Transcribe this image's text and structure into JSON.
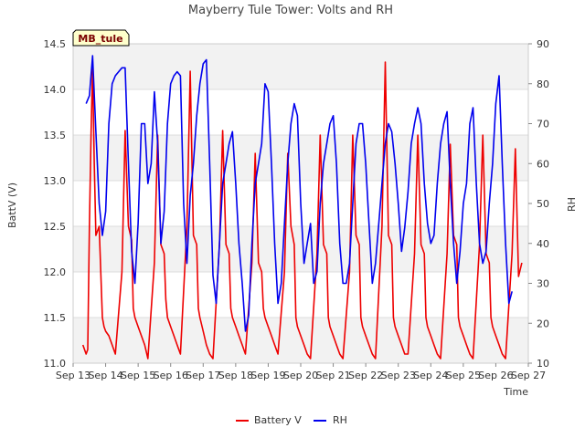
{
  "chart_data": {
    "type": "line",
    "title": "Mayberry Tule Tower: Volts and RH",
    "badge": "MB_tule",
    "xlabel": "Time",
    "ylabel_left": "BattV (V)",
    "ylabel_right": "RH",
    "x_ticks": [
      "Sep 13",
      "Sep 14",
      "Sep 15",
      "Sep 16",
      "Sep 17",
      "Sep 18",
      "Sep 19",
      "Sep 20",
      "Sep 21",
      "Sep 22",
      "Sep 23",
      "Sep 24",
      "Sep 25",
      "Sep 26",
      "Sep 27"
    ],
    "xlim_days": [
      13,
      27
    ],
    "ylim_left": [
      11.0,
      14.5
    ],
    "ylim_right": [
      10,
      90
    ],
    "y_ticks_left": [
      "11.0",
      "11.5",
      "12.0",
      "12.5",
      "13.0",
      "13.5",
      "14.0",
      "14.5"
    ],
    "y_ticks_right": [
      "10",
      "20",
      "30",
      "40",
      "50",
      "60",
      "70",
      "80",
      "90"
    ],
    "legend_position": "bottom-center",
    "series": [
      {
        "name": "Battery V",
        "color": "#ee0000",
        "axis": "left",
        "x_day": [
          13.3,
          13.4,
          13.45,
          13.5,
          13.55,
          13.6,
          13.65,
          13.7,
          13.8,
          13.9,
          13.95,
          14.0,
          14.1,
          14.2,
          14.3,
          14.5,
          14.6,
          14.7,
          14.8,
          14.85,
          14.9,
          15.0,
          15.1,
          15.2,
          15.3,
          15.5,
          15.6,
          15.7,
          15.8,
          15.85,
          15.9,
          16.0,
          16.1,
          16.2,
          16.3,
          16.5,
          16.6,
          16.7,
          16.8,
          16.85,
          16.9,
          17.0,
          17.1,
          17.2,
          17.3,
          17.5,
          17.6,
          17.7,
          17.8,
          17.85,
          17.9,
          18.0,
          18.1,
          18.2,
          18.3,
          18.5,
          18.6,
          18.7,
          18.8,
          18.85,
          18.9,
          19.0,
          19.1,
          19.2,
          19.3,
          19.5,
          19.6,
          19.7,
          19.8,
          19.85,
          19.9,
          20.0,
          20.1,
          20.2,
          20.3,
          20.5,
          20.6,
          20.7,
          20.8,
          20.85,
          20.9,
          21.0,
          21.1,
          21.2,
          21.3,
          21.5,
          21.6,
          21.7,
          21.8,
          21.85,
          21.9,
          22.0,
          22.1,
          22.2,
          22.3,
          22.5,
          22.6,
          22.7,
          22.8,
          22.85,
          22.9,
          23.0,
          23.1,
          23.2,
          23.3,
          23.5,
          23.6,
          23.7,
          23.8,
          23.85,
          23.9,
          24.0,
          24.1,
          24.2,
          24.3,
          24.5,
          24.6,
          24.7,
          24.8,
          24.85,
          24.9,
          25.0,
          25.1,
          25.2,
          25.3,
          25.5,
          25.6,
          25.7,
          25.8,
          25.85,
          25.9,
          26.0,
          26.1,
          26.2,
          26.3,
          26.5,
          26.6,
          26.7,
          26.8,
          26.85,
          26.9,
          27.0
        ],
        "values": [
          11.2,
          11.1,
          11.15,
          12.5,
          13.5,
          14.25,
          13.2,
          12.4,
          12.5,
          11.5,
          11.4,
          11.35,
          11.3,
          11.2,
          11.1,
          12.0,
          13.55,
          12.5,
          12.35,
          11.6,
          11.5,
          11.4,
          11.3,
          11.2,
          11.05,
          12.1,
          13.5,
          12.3,
          12.2,
          11.7,
          11.5,
          11.4,
          11.3,
          11.2,
          11.1,
          12.5,
          14.2,
          12.4,
          12.3,
          11.6,
          11.5,
          11.35,
          11.2,
          11.1,
          11.05,
          12.3,
          13.55,
          12.3,
          12.2,
          11.6,
          11.5,
          11.4,
          11.3,
          11.2,
          11.1,
          12.1,
          13.3,
          12.1,
          12.0,
          11.6,
          11.5,
          11.4,
          11.3,
          11.2,
          11.1,
          12.0,
          13.3,
          12.5,
          12.3,
          11.5,
          11.4,
          11.3,
          11.2,
          11.1,
          11.05,
          12.2,
          13.5,
          12.3,
          12.2,
          11.5,
          11.4,
          11.3,
          11.2,
          11.1,
          11.05,
          12.0,
          13.5,
          12.4,
          12.3,
          11.5,
          11.4,
          11.3,
          11.2,
          11.1,
          11.05,
          12.5,
          14.3,
          12.4,
          12.3,
          11.5,
          11.4,
          11.3,
          11.2,
          11.1,
          11.1,
          12.2,
          13.5,
          12.3,
          12.2,
          11.5,
          11.4,
          11.3,
          11.2,
          11.1,
          11.05,
          12.2,
          13.4,
          12.4,
          12.3,
          11.5,
          11.4,
          11.3,
          11.2,
          11.1,
          11.05,
          12.3,
          13.5,
          12.2,
          12.1,
          11.5,
          11.4,
          11.3,
          11.2,
          11.1,
          11.05,
          12.2,
          13.35,
          11.95,
          12.1
        ]
      },
      {
        "name": "RH",
        "color": "#0000ee",
        "axis": "right",
        "x_day": [
          13.4,
          13.5,
          13.6,
          13.7,
          13.8,
          13.9,
          14.0,
          14.1,
          14.2,
          14.3,
          14.4,
          14.5,
          14.6,
          14.7,
          14.8,
          14.9,
          15.0,
          15.1,
          15.2,
          15.3,
          15.4,
          15.5,
          15.6,
          15.7,
          15.8,
          15.9,
          16.0,
          16.1,
          16.2,
          16.3,
          16.4,
          16.5,
          16.6,
          16.7,
          16.8,
          16.9,
          17.0,
          17.1,
          17.2,
          17.3,
          17.4,
          17.5,
          17.6,
          17.7,
          17.8,
          17.9,
          18.0,
          18.1,
          18.2,
          18.3,
          18.4,
          18.5,
          18.6,
          18.7,
          18.8,
          18.9,
          19.0,
          19.1,
          19.2,
          19.3,
          19.4,
          19.5,
          19.6,
          19.7,
          19.8,
          19.9,
          20.0,
          20.1,
          20.2,
          20.3,
          20.4,
          20.5,
          20.6,
          20.7,
          20.8,
          20.9,
          21.0,
          21.1,
          21.2,
          21.3,
          21.4,
          21.5,
          21.6,
          21.7,
          21.8,
          21.9,
          22.0,
          22.1,
          22.2,
          22.3,
          22.4,
          22.5,
          22.6,
          22.7,
          22.8,
          22.9,
          23.0,
          23.1,
          23.2,
          23.3,
          23.4,
          23.5,
          23.6,
          23.7,
          23.8,
          23.9,
          24.0,
          24.1,
          24.2,
          24.3,
          24.4,
          24.5,
          24.6,
          24.7,
          24.8,
          24.9,
          25.0,
          25.1,
          25.2,
          25.3,
          25.4,
          25.5,
          25.6,
          25.7,
          25.8,
          25.9,
          26.0,
          26.1,
          26.2,
          26.3,
          26.4,
          26.5,
          26.6,
          26.7,
          26.8,
          26.9,
          27.0
        ],
        "values": [
          75,
          77,
          87,
          68,
          50,
          42,
          48,
          70,
          80,
          82,
          83,
          84,
          84,
          60,
          38,
          30,
          45,
          70,
          70,
          55,
          60,
          78,
          65,
          40,
          48,
          70,
          80,
          82,
          83,
          82,
          50,
          35,
          52,
          60,
          72,
          80,
          85,
          86,
          60,
          32,
          25,
          40,
          55,
          60,
          65,
          68,
          55,
          40,
          30,
          18,
          22,
          40,
          55,
          60,
          65,
          80,
          78,
          60,
          40,
          25,
          30,
          45,
          60,
          70,
          75,
          72,
          50,
          35,
          40,
          45,
          30,
          33,
          50,
          60,
          65,
          70,
          72,
          60,
          40,
          30,
          30,
          35,
          50,
          65,
          70,
          70,
          60,
          45,
          30,
          35,
          45,
          55,
          65,
          70,
          68,
          60,
          50,
          38,
          44,
          53,
          65,
          70,
          74,
          70,
          55,
          45,
          40,
          42,
          55,
          65,
          70,
          73,
          55,
          40,
          30,
          38,
          50,
          55,
          70,
          74,
          55,
          40,
          35,
          38,
          50,
          60,
          75,
          82,
          60,
          40,
          25,
          28
        ]
      }
    ]
  }
}
